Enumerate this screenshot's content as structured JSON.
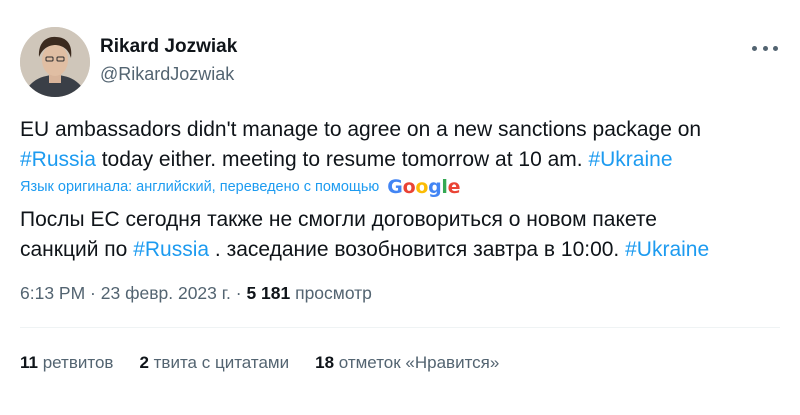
{
  "author": {
    "name": "Rikard Jozwiak",
    "handle": "@RikardJozwiak"
  },
  "tweet": {
    "part1": "EU ambassadors didn't manage to agree on a new sanctions package on",
    "hashtag1": "#Russia",
    "part2": " today either. meeting to resume tomorrow at 10 am. ",
    "hashtag2": "#Ukraine"
  },
  "translation_note": {
    "text": "Язык оригинала: английский, переведено с помощью",
    "brand": [
      "G",
      "o",
      "o",
      "g",
      "l",
      "e"
    ]
  },
  "translation": {
    "part1": "Послы ЕС сегодня также не смогли договориться о новом пакете",
    "part2": "санкций по ",
    "hashtag1": "#Russia",
    "part3": " . заседание возобновится завтра в 10:00. ",
    "hashtag2": "#Ukraine"
  },
  "meta": {
    "time": "6:13 PM",
    "sep1": " · ",
    "date": "23 февр. 2023 г.",
    "sep2": " · ",
    "views_count": "5 181",
    "views_label": " просмотр"
  },
  "stats": {
    "retweets_count": "11",
    "retweets_label": " ретвитов",
    "quotes_count": "2",
    "quotes_label": " твита с цитатами",
    "likes_count": "18",
    "likes_label": " отметок «Нравится»"
  },
  "colors": {
    "accent": "#1d9bf0",
    "text": "#0f1419",
    "secondary": "#536471"
  },
  "icons": {
    "more": "more-dots-icon"
  }
}
